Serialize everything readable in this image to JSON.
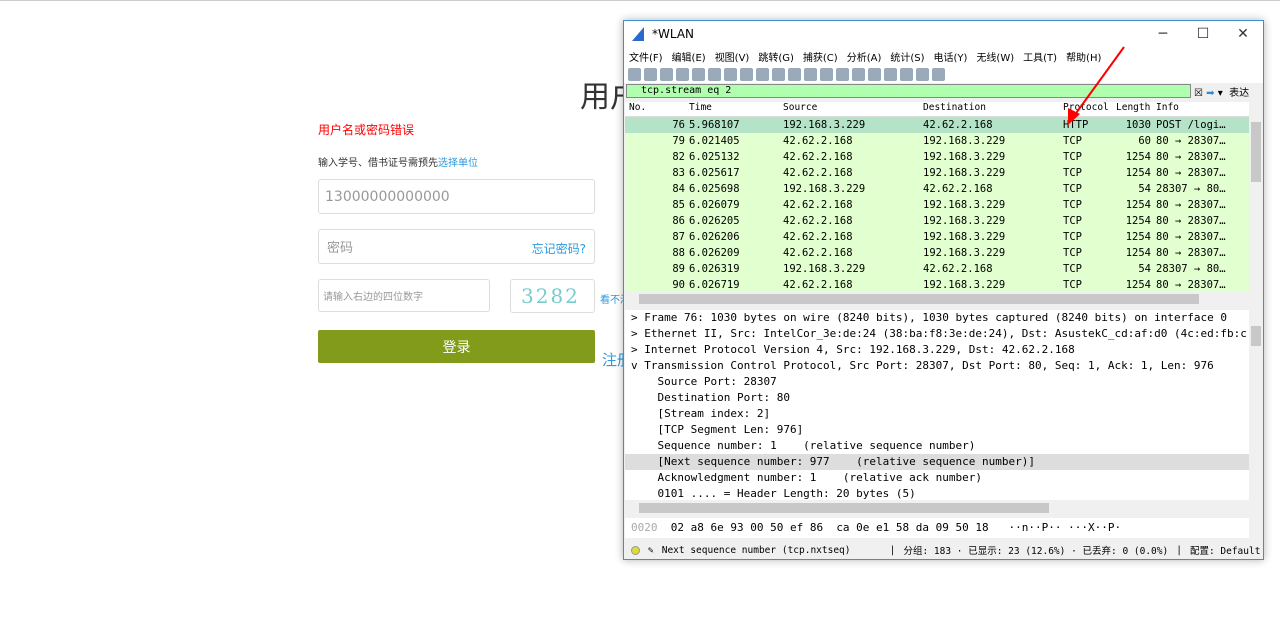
{
  "login": {
    "title": "用户",
    "error": "用户名或密码错误",
    "hint": "输入学号、借书证号需预先",
    "hint_link": "选择单位",
    "username_value": "13000000000000",
    "password_placeholder": "密码",
    "forgot": "忘记密码?",
    "captcha_placeholder": "请输入右边的四位数字",
    "captcha_text": "3282",
    "captcha_refresh": "看不清",
    "login_button": "登录",
    "register": "注册"
  },
  "window": {
    "title": "*WLAN",
    "menu": [
      "文件(F)",
      "编辑(E)",
      "视图(V)",
      "跳转(G)",
      "捕获(C)",
      "分析(A)",
      "统计(S)",
      "电话(Y)",
      "无线(W)",
      "工具(T)",
      "帮助(H)"
    ],
    "filter": "tcp.stream eq 2",
    "expression": "表达式…",
    "columns": [
      "No.",
      "Time",
      "Source",
      "Destination",
      "Protocol",
      "Length",
      "Info"
    ],
    "packets": [
      [
        "76",
        "5.968107",
        "192.168.3.229",
        "42.62.2.168",
        "HTTP",
        "1030",
        "POST /logi…"
      ],
      [
        "79",
        "6.021405",
        "42.62.2.168",
        "192.168.3.229",
        "TCP",
        "60",
        "80 → 28307…"
      ],
      [
        "82",
        "6.025132",
        "42.62.2.168",
        "192.168.3.229",
        "TCP",
        "1254",
        "80 → 28307…"
      ],
      [
        "83",
        "6.025617",
        "42.62.2.168",
        "192.168.3.229",
        "TCP",
        "1254",
        "80 → 28307…"
      ],
      [
        "84",
        "6.025698",
        "192.168.3.229",
        "42.62.2.168",
        "TCP",
        "54",
        "28307 → 80…"
      ],
      [
        "85",
        "6.026079",
        "42.62.2.168",
        "192.168.3.229",
        "TCP",
        "1254",
        "80 → 28307…"
      ],
      [
        "86",
        "6.026205",
        "42.62.2.168",
        "192.168.3.229",
        "TCP",
        "1254",
        "80 → 28307…"
      ],
      [
        "87",
        "6.026206",
        "42.62.2.168",
        "192.168.3.229",
        "TCP",
        "1254",
        "80 → 28307…"
      ],
      [
        "88",
        "6.026209",
        "42.62.2.168",
        "192.168.3.229",
        "TCP",
        "1254",
        "80 → 28307…"
      ],
      [
        "89",
        "6.026319",
        "192.168.3.229",
        "42.62.2.168",
        "TCP",
        "54",
        "28307 → 80…"
      ],
      [
        "90",
        "6.026719",
        "42.62.2.168",
        "192.168.3.229",
        "TCP",
        "1254",
        "80 → 28307…"
      ]
    ],
    "details": [
      "> Frame 76: 1030 bytes on wire (8240 bits), 1030 bytes captured (8240 bits) on interface 0",
      "> Ethernet II, Src: IntelCor_3e:de:24 (38:ba:f8:3e:de:24), Dst: AsustekC_cd:af:d0 (4c:ed:fb:c",
      "> Internet Protocol Version 4, Src: 192.168.3.229, Dst: 42.62.2.168",
      "v Transmission Control Protocol, Src Port: 28307, Dst Port: 80, Seq: 1, Ack: 1, Len: 976",
      "    Source Port: 28307",
      "    Destination Port: 80",
      "    [Stream index: 2]",
      "    [TCP Segment Len: 976]",
      "    Sequence number: 1    (relative sequence number)",
      "    [Next sequence number: 977    (relative sequence number)]",
      "    Acknowledgment number: 1    (relative ack number)",
      "    0101 .... = Header Length: 20 bytes (5)"
    ],
    "hex_offset": "0020",
    "hex_bytes": "02 a8 6e 93 00 50 ef 86  ca 0e e1 58 da 09 50 18",
    "hex_ascii": "··n··P·· ···X··P·",
    "status": {
      "field": "Next sequence number (tcp.nxtseq)",
      "packets": "分组: 183 · 已显示: 23 (12.6%) · 已丢弃: 0 (0.0%)",
      "profile": "配置: Default"
    }
  }
}
